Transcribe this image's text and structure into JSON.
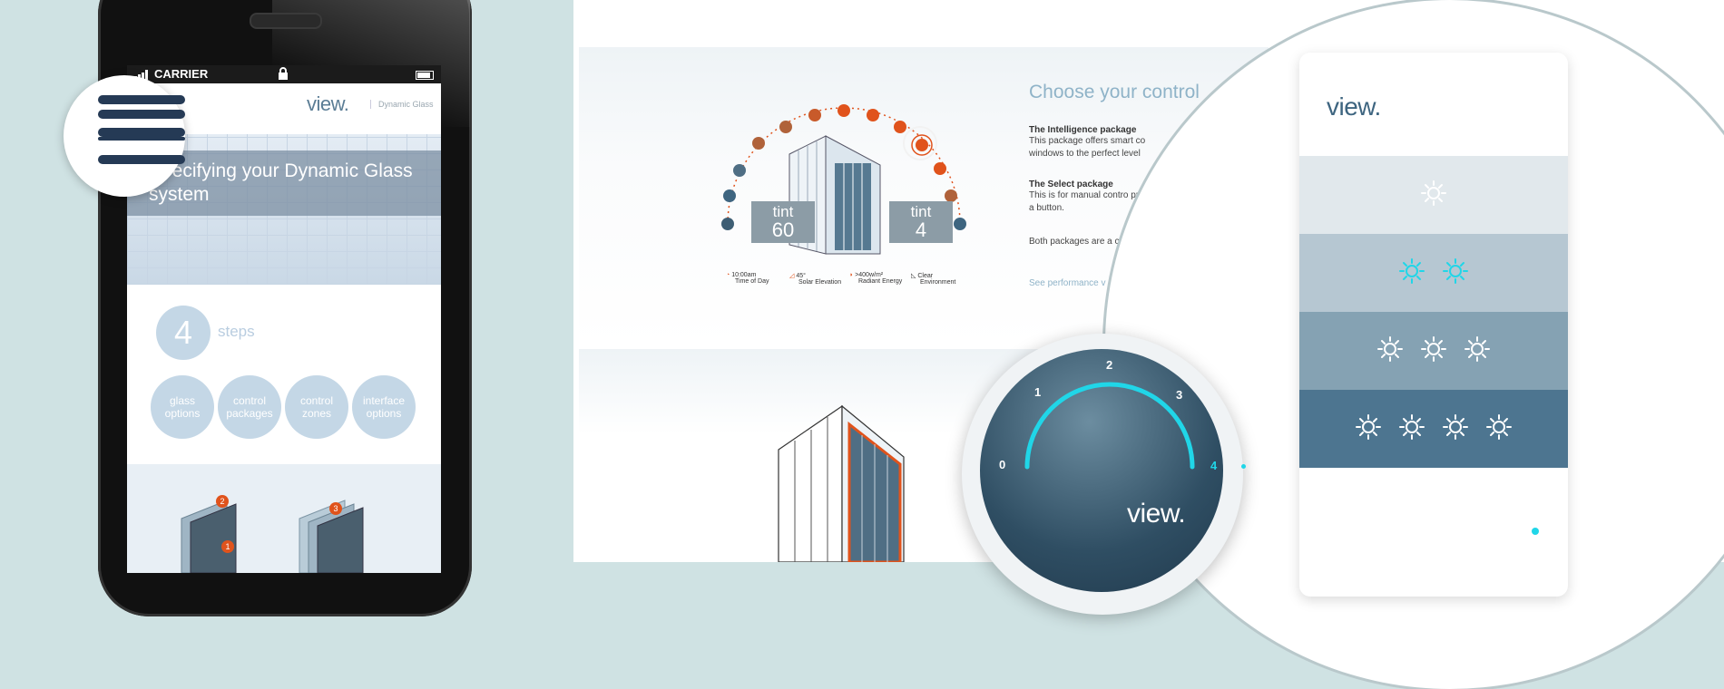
{
  "phone": {
    "status": {
      "carrier": "CARRIER"
    },
    "app": {
      "logo": "view.",
      "tagline": "Dynamic Glass",
      "hero_title": "Specifying your Dynamic Glass system",
      "steps_number": "4",
      "steps_label": "steps",
      "options": [
        {
          "label": "glass options"
        },
        {
          "label": "control packages"
        },
        {
          "label": "control zones"
        },
        {
          "label": "interface options"
        }
      ],
      "panel_badges": [
        "2",
        "3",
        "1"
      ]
    }
  },
  "controls_panel": {
    "title": "Choose your control",
    "packages": [
      {
        "heading": "The Intelligence package",
        "text": "This package offers smart co windows to the perfect level"
      },
      {
        "heading": "The Select package",
        "text": "This is for manual contro push of a button."
      }
    ],
    "both_text": "Both packages are a control.",
    "performance_link": "See performance v",
    "tint_left": {
      "label": "tint",
      "value": "60"
    },
    "tint_right": {
      "label": "tint",
      "value": "4"
    },
    "legend": [
      {
        "value": "10:00am",
        "label": "Time of Day"
      },
      {
        "value": "45°",
        "label": "Solar Elevation"
      },
      {
        "value": ">400w/m²",
        "label": "Radiant Energy"
      },
      {
        "value": "Clear",
        "label": "Environment"
      }
    ]
  },
  "dial": {
    "ticks": [
      "0",
      "1",
      "2",
      "3",
      "4"
    ],
    "logo": "view."
  },
  "tint_card": {
    "logo": "view.",
    "levels": [
      {
        "suns": 1,
        "color": "#e1e8ec",
        "sun_color": "#ffffff"
      },
      {
        "suns": 2,
        "color": "#b6c7d2",
        "sun_color": "#20d6e8"
      },
      {
        "suns": 3,
        "color": "#85a2b3",
        "sun_color": "#ffffff"
      },
      {
        "suns": 4,
        "color": "#4d7590",
        "sun_color": "#ffffff"
      }
    ],
    "accent": "#20d6e8"
  },
  "colors": {
    "accent_orange": "#e0531c",
    "brand_blue": "#3e6580",
    "cyan": "#20d6e8"
  }
}
